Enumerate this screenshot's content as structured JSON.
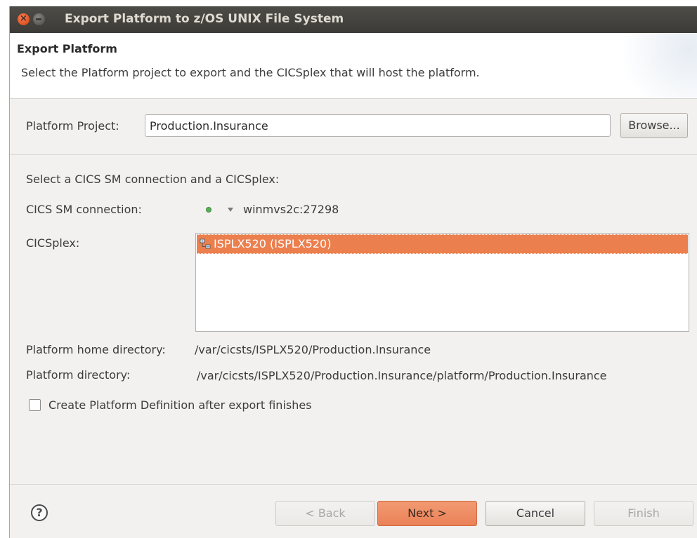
{
  "window": {
    "title": "Export Platform to z/OS UNIX File System",
    "close_glyph": "×"
  },
  "header": {
    "title": "Export Platform",
    "description": "Select the Platform project to export and the CICSplex that will host the platform."
  },
  "platform_project": {
    "label": "Platform Project:",
    "value": "Production.Insurance",
    "browse_label": "Browse..."
  },
  "connection_section": {
    "prompt": "Select a CICS SM connection and a CICSplex:",
    "connection_label": "CICS SM connection:",
    "connection_value": "winmvs2c:27298",
    "connection_status_color": "#5ab05a",
    "cicsplex_label": "CICSplex:",
    "cicsplex_items": [
      {
        "label": "ISPLX520 (ISPLX520)",
        "selected": true,
        "icon": "cicsplex-icon"
      }
    ]
  },
  "directories": {
    "home_label": "Platform home directory:",
    "home_value": "/var/cicsts/ISPLX520/Production.Insurance",
    "platform_label": "Platform directory:",
    "platform_value": "/var/cicsts/ISPLX520/Production.Insurance/platform/Production.Insurance"
  },
  "options": {
    "create_definition_label": "Create Platform Definition after export finishes",
    "create_definition_checked": false
  },
  "footer": {
    "help_glyph": "?",
    "back_label": "< Back",
    "next_label": "Next >",
    "cancel_label": "Cancel",
    "finish_label": "Finish"
  },
  "colors": {
    "accent": "#ec7f4e",
    "titlebar": "#3c3b37"
  }
}
